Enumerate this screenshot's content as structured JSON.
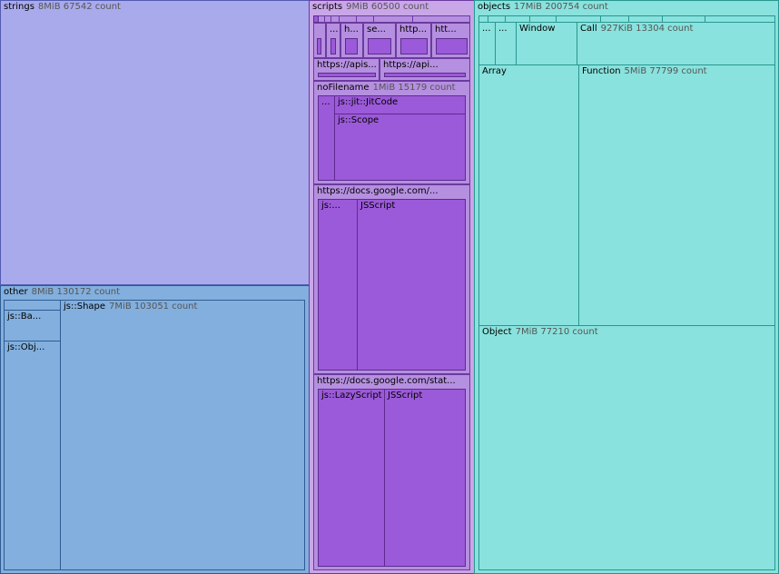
{
  "treemap": {
    "strings": {
      "name": "strings",
      "size": "8MiB",
      "count": "67542 count"
    },
    "other": {
      "name": "other",
      "size": "8MiB",
      "count": "130172 count",
      "children": {
        "js_ba": "js::Ba...",
        "js_obj": "js::Obj...",
        "js_shape": {
          "name": "js::Shape",
          "size": "7MiB",
          "count": "103051 count"
        }
      }
    },
    "scripts": {
      "name": "scripts",
      "size": "9MiB",
      "count": "60500 count",
      "small_labels": [
        "...",
        "h...",
        "se...",
        "http...",
        "htt..."
      ],
      "apis": [
        "https://apis...",
        "https://api..."
      ],
      "nofilename": {
        "name": "noFilename",
        "size": "1MiB",
        "count": "15179 count",
        "ellipsis": "...",
        "jitcode": "js::jit::JitCode",
        "scope": "js::Scope"
      },
      "docs1": {
        "name": "https://docs.google.com/...",
        "js": "js:...",
        "jsscript": "JSScript"
      },
      "docs2": {
        "name": "https://docs.google.com/stat...",
        "lazy": "js::LazyScript",
        "jsscript": "JSScript"
      }
    },
    "objects": {
      "name": "objects",
      "size": "17MiB",
      "count": "200754 count",
      "ellipsis1": "...",
      "ellipsis2": "...",
      "window": "Window",
      "call": {
        "name": "Call",
        "size": "927KiB",
        "count": "13304 count"
      },
      "array": "Array",
      "function": {
        "name": "Function",
        "size": "5MiB",
        "count": "77799 count"
      },
      "object": {
        "name": "Object",
        "size": "7MiB",
        "count": "77210 count"
      }
    }
  }
}
